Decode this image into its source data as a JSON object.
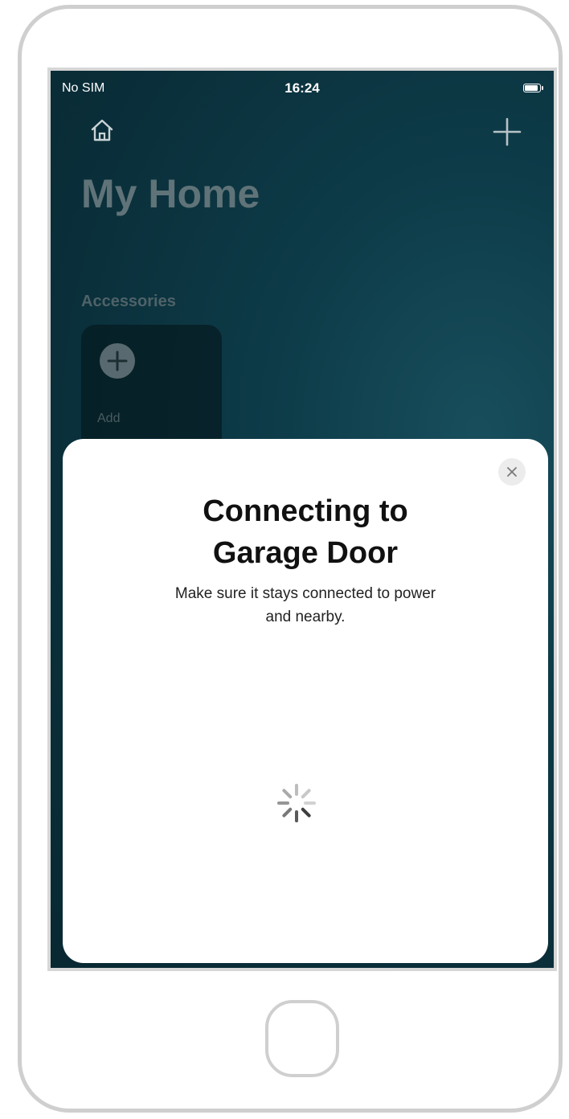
{
  "status_bar": {
    "carrier": "No SIM",
    "time": "16:24"
  },
  "header": {
    "home_icon": "house-icon",
    "add_icon": "plus-icon",
    "title": "My Home"
  },
  "accessories": {
    "section_label": "Accessories",
    "add_tile_label": "Add",
    "add_tile_icon": "plus-circle-icon"
  },
  "dialog": {
    "title_line1": "Connecting to",
    "title_line2": "Garage Door",
    "subtitle_line1": "Make sure it stays connected to power",
    "subtitle_line2": "and nearby.",
    "close_icon": "close-icon",
    "loading_icon": "spinner-icon"
  },
  "colors": {
    "background": "#0d3b48",
    "sheet": "#ffffff",
    "title_text": "#111111"
  }
}
